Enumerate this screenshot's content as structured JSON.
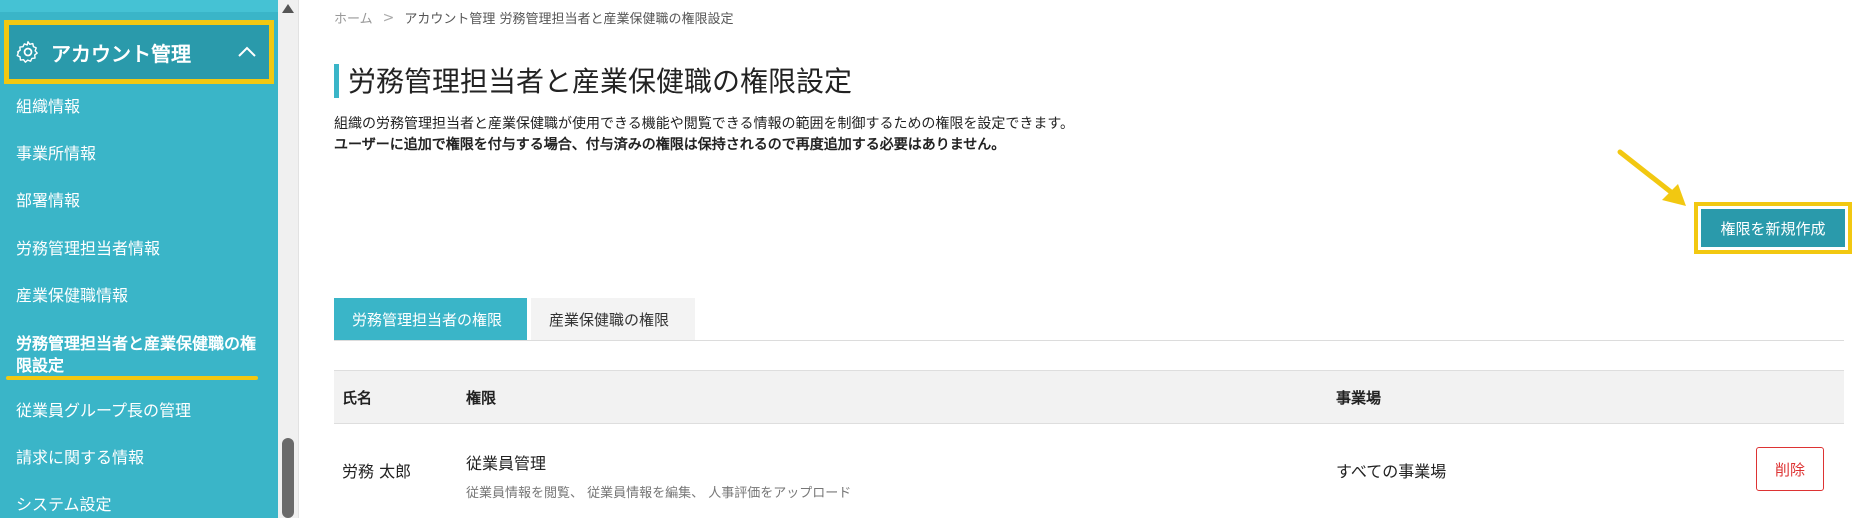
{
  "sidebar": {
    "section_title": "アカウント管理",
    "items": [
      {
        "label": "組織情報"
      },
      {
        "label": "事業所情報"
      },
      {
        "label": "部署情報"
      },
      {
        "label": "労務管理担当者情報"
      },
      {
        "label": "産業保健職情報"
      },
      {
        "label": "労務管理担当者と産業保健職の権限設定",
        "active": true
      },
      {
        "label": "従業員グループ長の管理"
      },
      {
        "label": "請求に関する情報"
      },
      {
        "label": "システム設定"
      }
    ]
  },
  "breadcrumb": {
    "home": "ホーム",
    "separator": ">",
    "current": "アカウント管理 労務管理担当者と産業保健職の権限設定"
  },
  "page": {
    "title": "労務管理担当者と産業保健職の権限設定",
    "description": "組織の労務管理担当者と産業保健職が使用できる機能や閲覧できる情報の範囲を制御するための権限を設定できます。",
    "note": "ユーザーに追加で権限を付与する場合、付与済みの権限は保持されるので再度追加する必要はありません。",
    "new_button": "権限を新規作成"
  },
  "tabs": [
    {
      "label": "労務管理担当者の権限",
      "active": true
    },
    {
      "label": "産業保健職の権限",
      "active": false
    }
  ],
  "table": {
    "headers": [
      "氏名",
      "権限",
      "事業場"
    ],
    "rows": [
      {
        "name": "労務 太郎",
        "permission": "従業員管理",
        "permission_detail": "従業員情報を閲覧、 従業員情報を編集、 人事評価をアップロード",
        "site": "すべての事業場",
        "delete_label": "削除"
      }
    ]
  },
  "colors": {
    "sidebar_bg": "#3ab5c8",
    "accent": "#2a9aab",
    "highlight": "#f2c811",
    "danger": "#dd3333"
  }
}
